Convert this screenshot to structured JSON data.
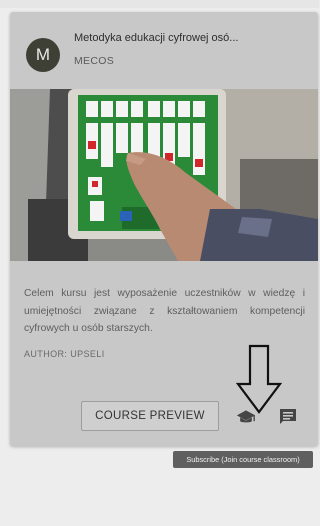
{
  "course": {
    "avatar_letter": "M",
    "title": "Metodyka edukacji cyfrowej osó...",
    "organization": "MECOS",
    "description": "Celem kursu jest wyposażenie uczestników w wiedzę i umiejętności związane z kształtowaniem kompetencji cyfrowych u osób starszych.",
    "author": "AUTHOR: UPSELI"
  },
  "actions": {
    "preview_label": "COURSE PREVIEW",
    "subscribe_icon": "school-icon",
    "comment_icon": "comment-icon"
  },
  "tooltip": {
    "text": "Subscribe (Join course classroom)"
  },
  "colors": {
    "card_background": "#c8c8c8",
    "avatar_background": "#3e4036",
    "icon_color": "#454545",
    "tooltip_background": "#5f5f5f",
    "solitaire_felt": "#2a8a38"
  }
}
